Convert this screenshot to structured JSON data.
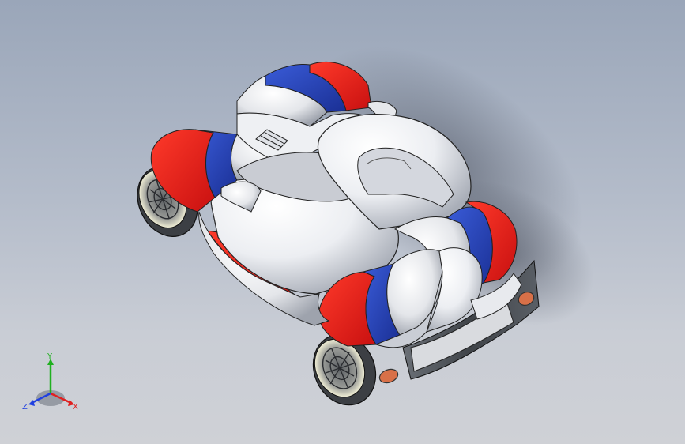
{
  "viewport": {
    "background_top": "#9aa6b9",
    "background_bottom": "#cfd1d6",
    "model_name": "kart-vehicle-3d-model"
  },
  "colors": {
    "stripe_red": "#e02020",
    "stripe_blue": "#2244b8",
    "body_white": "#f4f4f6",
    "body_shade": "#b8bcc6",
    "dark_metal": "#555a60",
    "light_orange": "#e07850",
    "rim": "#e8e6cc"
  },
  "triad": {
    "x_label": "X",
    "y_label": "Y",
    "z_label": "Z",
    "x_color": "#e02020",
    "y_color": "#20b020",
    "z_color": "#2040e0"
  }
}
